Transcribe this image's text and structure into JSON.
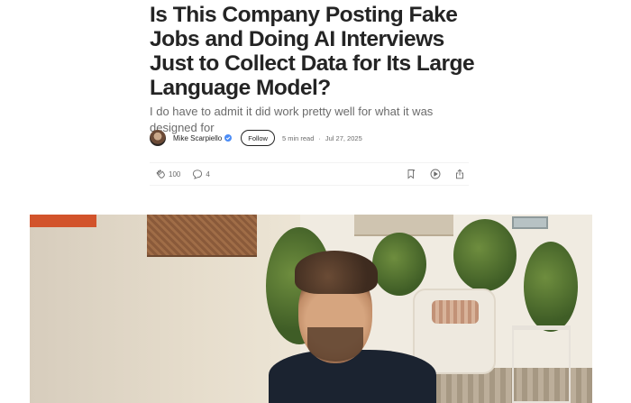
{
  "article": {
    "title": "Is This Company Posting Fake Jobs and Doing AI Interviews Just to Collect Data for Its Large Language Model?",
    "subtitle": "I do have to admit it did work pretty well for what it was designed for"
  },
  "byline": {
    "author": "Mike Scarpiello",
    "follow_label": "Follow",
    "read_time": "5 min read",
    "separator": "·",
    "date": "Jul 27, 2025"
  },
  "actions": {
    "claps": "100",
    "responses": "4",
    "icons": [
      "clap-icon",
      "response-icon",
      "bookmark-icon",
      "play-icon",
      "share-icon"
    ]
  },
  "colors": {
    "text": "#242424",
    "muted": "#6b6b6b",
    "verified": "#4c8df6"
  }
}
